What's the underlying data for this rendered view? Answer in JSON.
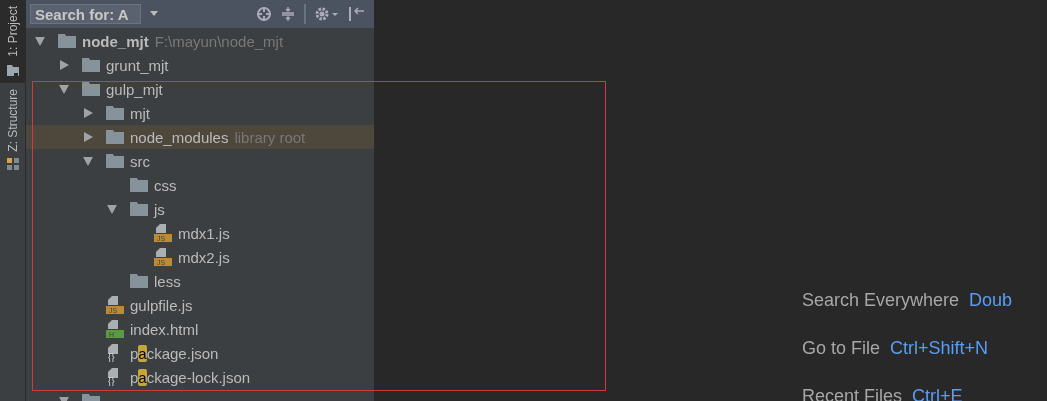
{
  "side_tabs": [
    {
      "label": "1: Project",
      "selected": true
    },
    {
      "label": "Z: Structure",
      "selected": false
    }
  ],
  "toolbar": {
    "search": {
      "value": "Search for: A"
    }
  },
  "tree": [
    {
      "kind": "folder",
      "name_parts": [
        {
          "text": "node_mjt",
          "match": false
        }
      ],
      "path": "F:\\mayun\\node_mjt",
      "expanded": true,
      "selected": false,
      "children": [
        {
          "kind": "folder",
          "name_parts": [
            {
              "text": "grunt_mjt",
              "match": false
            }
          ],
          "expanded": false,
          "selected": false
        },
        {
          "kind": "folder",
          "name_parts": [
            {
              "text": "gulp_mjt",
              "match": false
            }
          ],
          "expanded": true,
          "selected": false,
          "children": [
            {
              "kind": "folder",
              "name_parts": [
                {
                  "text": "mjt",
                  "match": false
                }
              ],
              "expanded": false,
              "selected": false
            },
            {
              "kind": "folder",
              "name_parts": [
                {
                  "text": "node_modules",
                  "match": false
                }
              ],
              "note": "library root",
              "expanded": false,
              "selected": true
            },
            {
              "kind": "folder",
              "name_parts": [
                {
                  "text": "src",
                  "match": false
                }
              ],
              "expanded": true,
              "selected": false,
              "children": [
                {
                  "kind": "folder",
                  "name_parts": [
                    {
                      "text": "css",
                      "match": false
                    }
                  ],
                  "selected": false
                },
                {
                  "kind": "folder",
                  "name_parts": [
                    {
                      "text": "js",
                      "match": false
                    }
                  ],
                  "expanded": true,
                  "selected": false,
                  "children": [
                    {
                      "kind": "js",
                      "badge": "JS",
                      "name_parts": [
                        {
                          "text": "mdx1.js",
                          "match": false
                        }
                      ],
                      "selected": false
                    },
                    {
                      "kind": "js",
                      "badge": "JS",
                      "name_parts": [
                        {
                          "text": "mdx2.js",
                          "match": false
                        }
                      ],
                      "selected": false
                    }
                  ]
                },
                {
                  "kind": "folder",
                  "name_parts": [
                    {
                      "text": "less",
                      "match": false
                    }
                  ],
                  "selected": false
                }
              ]
            },
            {
              "kind": "js",
              "badge": "JS",
              "name_parts": [
                {
                  "text": "gulpfile.js",
                  "match": false
                }
              ],
              "selected": false
            },
            {
              "kind": "html",
              "badge": "H",
              "name_parts": [
                {
                  "text": "index.html",
                  "match": false
                }
              ],
              "selected": false
            },
            {
              "kind": "json",
              "badge": "{}",
              "name_parts": [
                {
                  "text": "p",
                  "match": false
                },
                {
                  "text": "a",
                  "match": true
                },
                {
                  "text": "ckage.json",
                  "match": false
                }
              ],
              "selected": false
            },
            {
              "kind": "json",
              "badge": "{}",
              "name_parts": [
                {
                  "text": "p",
                  "match": false
                },
                {
                  "text": "a",
                  "match": true
                },
                {
                  "text": "ckage-lock.json",
                  "match": false
                }
              ],
              "selected": false
            }
          ]
        },
        {
          "kind": "folder",
          "expanded": true,
          "selected": false
        }
      ]
    }
  ],
  "hints": [
    {
      "label": "Search Everywhere",
      "shortcut": "Doub"
    },
    {
      "label": "Go to File",
      "shortcut": "Ctrl+Shift+N"
    },
    {
      "label": "Recent Files",
      "shortcut": "Ctrl+E"
    }
  ]
}
